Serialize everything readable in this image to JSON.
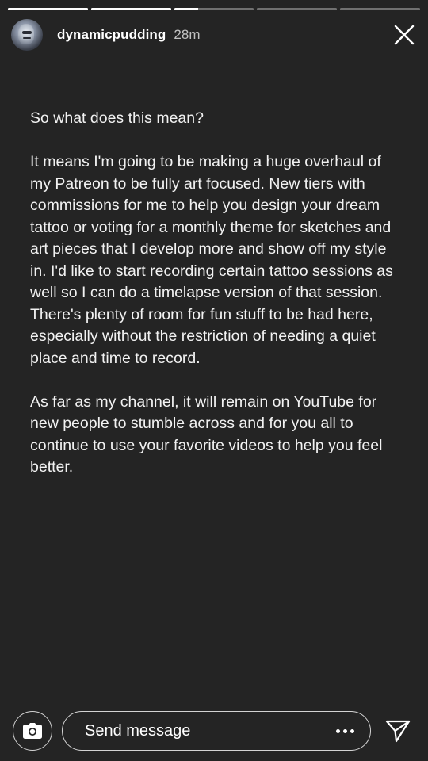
{
  "story": {
    "segments": [
      {
        "progress": 1.0
      },
      {
        "progress": 1.0
      },
      {
        "progress": 0.3
      },
      {
        "progress": 0.0
      },
      {
        "progress": 0.0
      }
    ]
  },
  "header": {
    "username": "dynamicpudding",
    "time_ago": "28m",
    "close_icon": "close-icon"
  },
  "content": {
    "paragraphs": [
      "So what does this mean?",
      "It means I'm going to be making a huge overhaul of my Patreon to be fully art focused. New tiers with commissions for me to help you design your dream tattoo or voting for a monthly theme for sketches and art pieces that I develop more and show off my style in. I'd like to start recording certain tattoo sessions as well so I can do a timelapse version of that session. There's plenty of room for fun stuff to be had here, especially without the restriction of needing a quiet place and time to record.",
      "As far as my channel, it will remain on YouTube for new people to stumble across and for you all to continue to use your favorite videos to help you feel better."
    ]
  },
  "footer": {
    "camera_icon": "camera-icon",
    "message_placeholder": "Send message",
    "more_icon": "more-options-icon",
    "send_icon": "paper-plane-icon"
  },
  "colors": {
    "background": "#242424",
    "text": "#f2f2f2",
    "progress_active": "#ffffff",
    "progress_inactive": "rgba(255,255,255,0.35)"
  }
}
